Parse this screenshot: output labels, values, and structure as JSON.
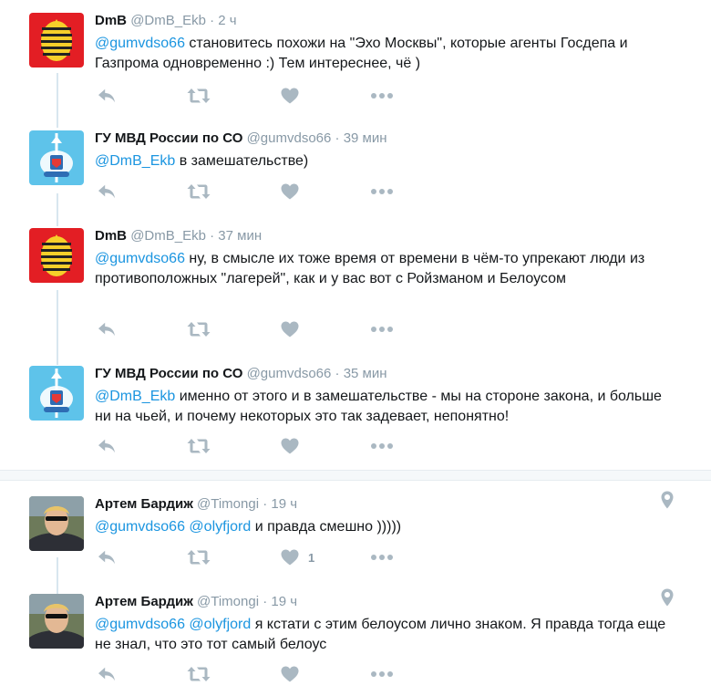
{
  "colors": {
    "link": "#1b95e0",
    "muted": "#8899a6",
    "action": "#aab8c2",
    "thread_line": "#d8e6ef"
  },
  "tweets": [
    {
      "name": "DmB",
      "handle": "@DmB_Ekb",
      "sep": "·",
      "time": "2 ч",
      "mention": "@gumvdso66",
      "text": " становитесь похожи на \"Эхо Москвы\", которые агенты Госдепа и Газпрома одновременно :) Тем интереснее, чё )",
      "avatar": "dmb-logo"
    },
    {
      "name": "ГУ МВД России по СО",
      "handle": "@gumvdso66",
      "sep": "·",
      "time": "39 мин",
      "mention": "@DmB_Ekb",
      "text": " в замешательстве)",
      "avatar": "police-emblem"
    },
    {
      "name": "DmB",
      "handle": "@DmB_Ekb",
      "sep": "·",
      "time": "37 мин",
      "mention": "@gumvdso66",
      "text": " ну, в смысле их тоже время от времени в чём-то упрекают люди из противоположных \"лагерей\", как и у вас вот с Ройзманом и Белоусом",
      "avatar": "dmb-logo"
    },
    {
      "name": "ГУ МВД России по СО",
      "handle": "@gumvdso66",
      "sep": "·",
      "time": "35 мин",
      "mention": "@DmB_Ekb",
      "text": " именно от этого и в замешательстве - мы на стороне закона, и больше ни на чьей, и почему некоторых это так задевает, непонятно!",
      "avatar": "police-emblem"
    },
    {
      "name": "Артем Бардиж",
      "handle": "@Timongi",
      "sep": "·",
      "time": "19 ч",
      "mention": "@gumvdso66",
      "mention2": "@olyfjord",
      "text": " и правда смешно )))))",
      "likes": "1",
      "avatar": "user-photo"
    },
    {
      "name": "Артем Бардиж",
      "handle": "@Timongi",
      "sep": "·",
      "time": "19 ч",
      "mention": "@gumvdso66",
      "mention2": "@olyfjord",
      "text": " я кстати с этим белоусом лично знаком. Я правда тогда еще не знал, что это тот самый белоус",
      "avatar": "user-photo"
    }
  ]
}
